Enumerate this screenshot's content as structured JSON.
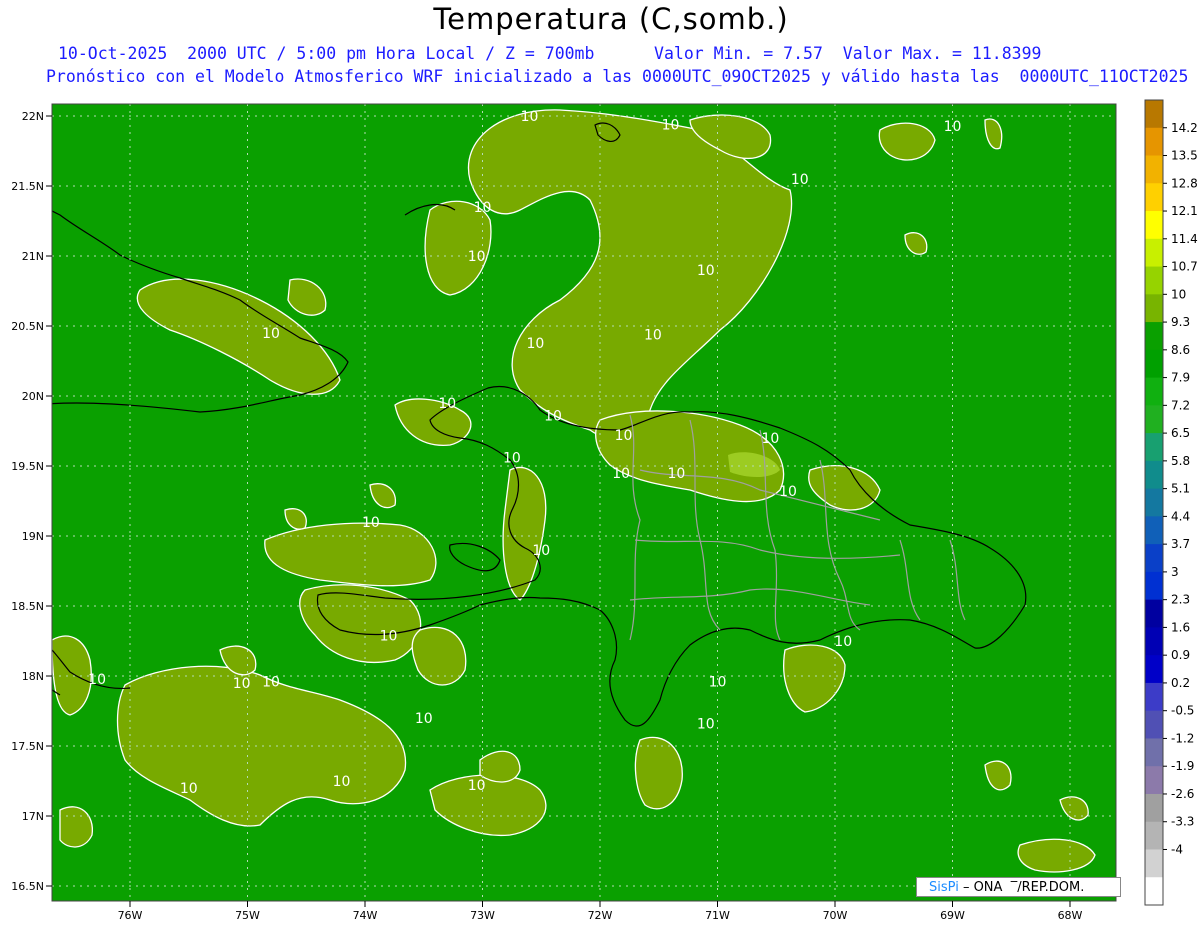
{
  "title": "Temperatura (C,somb.)",
  "subtitle_line1": "10-Oct-2025  2000 UTC / 5:00 pm Hora Local / Z = 700mb      Valor Min. = 7.57  Valor Max. = 11.8399",
  "subtitle_line2": "Pronóstico con el Modelo Atmosferico WRF inicializado a las 0000UTC_09OCT2025 y válido hasta las  0000UTC_11OCT2025",
  "credit": {
    "logo": "SisPi",
    "separator": " – ONA  ‾/REP.DOM."
  },
  "lat_labels": [
    "22N",
    "21.5N",
    "21N",
    "20.5N",
    "20N",
    "19.5N",
    "19N",
    "18.5N",
    "18N",
    "17.5N",
    "17N",
    "16.5N"
  ],
  "lon_labels": [
    "76W",
    "75W",
    "74W",
    "73W",
    "72W",
    "71W",
    "70W",
    "69W",
    "68W"
  ],
  "lat_values": [
    22,
    21.5,
    21,
    20.5,
    20,
    19.5,
    19,
    18.5,
    18,
    17.5,
    17,
    16.5
  ],
  "lon_values": [
    -76,
    -75,
    -74,
    -73,
    -72,
    -71,
    -70,
    -69,
    -68
  ],
  "contour_labels": [
    {
      "text": "10",
      "lon": -72.6,
      "lat": 22.0
    },
    {
      "text": "10",
      "lon": -71.4,
      "lat": 21.94
    },
    {
      "text": "10",
      "lon": -69.0,
      "lat": 21.93
    },
    {
      "text": "10",
      "lon": -70.3,
      "lat": 21.55
    },
    {
      "text": "10",
      "lon": -73.0,
      "lat": 21.35
    },
    {
      "text": "10",
      "lon": -73.05,
      "lat": 21.0
    },
    {
      "text": "10",
      "lon": -71.1,
      "lat": 20.9
    },
    {
      "text": "10",
      "lon": -74.8,
      "lat": 20.45
    },
    {
      "text": "10",
      "lon": -72.55,
      "lat": 20.38
    },
    {
      "text": "10",
      "lon": -71.55,
      "lat": 20.44
    },
    {
      "text": "10",
      "lon": -73.3,
      "lat": 19.95
    },
    {
      "text": "10",
      "lon": -72.4,
      "lat": 19.86
    },
    {
      "text": "10",
      "lon": -71.8,
      "lat": 19.72
    },
    {
      "text": "10",
      "lon": -72.75,
      "lat": 19.56
    },
    {
      "text": "10",
      "lon": -71.35,
      "lat": 19.45
    },
    {
      "text": "10",
      "lon": -71.82,
      "lat": 19.45
    },
    {
      "text": "10",
      "lon": -70.55,
      "lat": 19.7
    },
    {
      "text": "10",
      "lon": -70.4,
      "lat": 19.32
    },
    {
      "text": "10",
      "lon": -73.95,
      "lat": 19.1
    },
    {
      "text": "10",
      "lon": -72.5,
      "lat": 18.9
    },
    {
      "text": "10",
      "lon": -73.8,
      "lat": 18.29
    },
    {
      "text": "10",
      "lon": -69.93,
      "lat": 18.25
    },
    {
      "text": "10",
      "lon": -71.0,
      "lat": 17.96
    },
    {
      "text": "10",
      "lon": -76.28,
      "lat": 17.98
    },
    {
      "text": "10",
      "lon": -75.05,
      "lat": 17.95
    },
    {
      "text": "10",
      "lon": -74.8,
      "lat": 17.96
    },
    {
      "text": "10",
      "lon": -73.5,
      "lat": 17.7
    },
    {
      "text": "10",
      "lon": -71.1,
      "lat": 17.66
    },
    {
      "text": "10",
      "lon": -73.05,
      "lat": 17.22
    },
    {
      "text": "10",
      "lon": -75.5,
      "lat": 17.2
    },
    {
      "text": "10",
      "lon": -74.2,
      "lat": 17.25
    }
  ],
  "colorbar": {
    "labels": [
      "14.2",
      "13.5",
      "12.8",
      "12.1",
      "11.4",
      "10.7",
      "10",
      "9.3",
      "8.6",
      "7.9",
      "7.2",
      "6.5",
      "5.8",
      "5.1",
      "4.4",
      "3.7",
      "3",
      "2.3",
      "1.6",
      "0.9",
      "0.2",
      "-0.5",
      "-1.2",
      "-1.9",
      "-2.6",
      "-3.3",
      "-4"
    ],
    "colors": [
      "#b87800",
      "#e69500",
      "#f2b200",
      "#ffd000",
      "#ffff00",
      "#c8f000",
      "#96d300",
      "#78b400",
      "#0aa000",
      "#00a000",
      "#10b010",
      "#20b020",
      "#18a070",
      "#108c8c",
      "#1478a0",
      "#1060b8",
      "#0a40c8",
      "#0030d2",
      "#0000a0",
      "#0000b4",
      "#0000c8",
      "#3c3cc8",
      "#5050b4",
      "#7070aa",
      "#8c7aaa",
      "#a0a0a0",
      "#b4b4b4",
      "#d2d2d2",
      "#ffffff"
    ]
  },
  "field_colors": {
    "background": "#0aa000",
    "warm": "#78aa00",
    "warmest": "#9ccc22",
    "contour": "#ffffff",
    "coast": "#000000",
    "borders": "#a0a0a0"
  }
}
